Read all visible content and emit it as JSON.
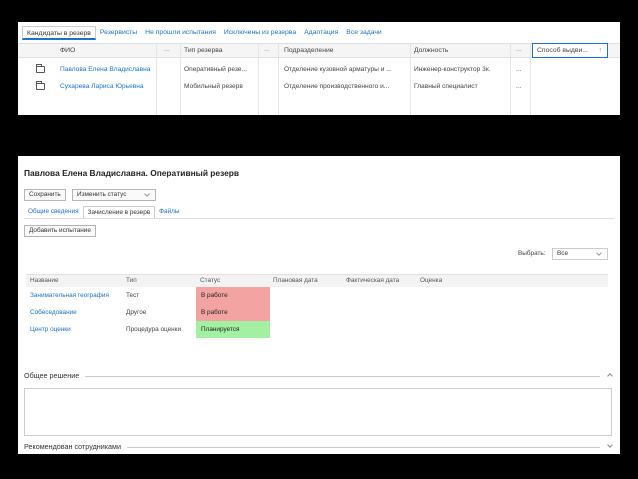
{
  "top_tabs": [
    {
      "label": "Кандидаты в резерв",
      "active": true
    },
    {
      "label": "Резервисты"
    },
    {
      "label": "Не прошли испытания"
    },
    {
      "label": "Исключены из резерва"
    },
    {
      "label": "Адаптация"
    },
    {
      "label": "Все задачи"
    }
  ],
  "grid": {
    "columns": {
      "fio": "ФИО",
      "type": "Тип резерва",
      "division": "Подразделение",
      "position": "Должность",
      "sort": "Способ выдви..."
    },
    "more": "...",
    "sort_icon": "sort-up-arrow-icon",
    "rows": [
      {
        "fio": "Павлова Елена Владиславна",
        "type": "Оперативный резе...",
        "division": "Отделение кузовной арматуры и ...",
        "position": "Инженер-конструктор 3к.",
        "more": "..."
      },
      {
        "fio": "Сухарева Лариса Юрьевна",
        "type": "Мобильный резерв",
        "division": "Отделение производственного и...",
        "position": "Главный специалист",
        "more": "..."
      }
    ]
  },
  "detail": {
    "title": "Павлова Елена Владиславна. Оперативный резерв",
    "save_label": "Сохранить",
    "status_label": "Изменить статус",
    "tabs": [
      {
        "label": "Общие сведения"
      },
      {
        "label": "Зачисление в резерв",
        "active": true
      },
      {
        "label": "Файлы"
      }
    ],
    "add_test_label": "Добавить испытание",
    "select_label": "Выбрать:",
    "select_value": "Все",
    "table": {
      "headers": {
        "name": "Название",
        "type": "Тип",
        "status": "Статус",
        "planned": "Плановая дата",
        "actual": "Фактическая дата",
        "score": "Оценка"
      },
      "rows": [
        {
          "name": "Занимательная география",
          "type": "Тест",
          "status": "В работе",
          "status_color": "#f4a3a3"
        },
        {
          "name": "Собеседование",
          "type": "Другое",
          "status": "В работе",
          "status_color": "#f4a3a3"
        },
        {
          "name": "Центр оценки",
          "type": "Процедура оценки",
          "status": "Планируется",
          "status_color": "#a3f0a3"
        }
      ]
    },
    "section_decision": "Общее решение",
    "section_recommended": "Рекомендован сотрудниками"
  },
  "colors": {
    "link": "#1a73c8",
    "in_work": "#f4a3a3",
    "planned": "#a3f0a3"
  }
}
